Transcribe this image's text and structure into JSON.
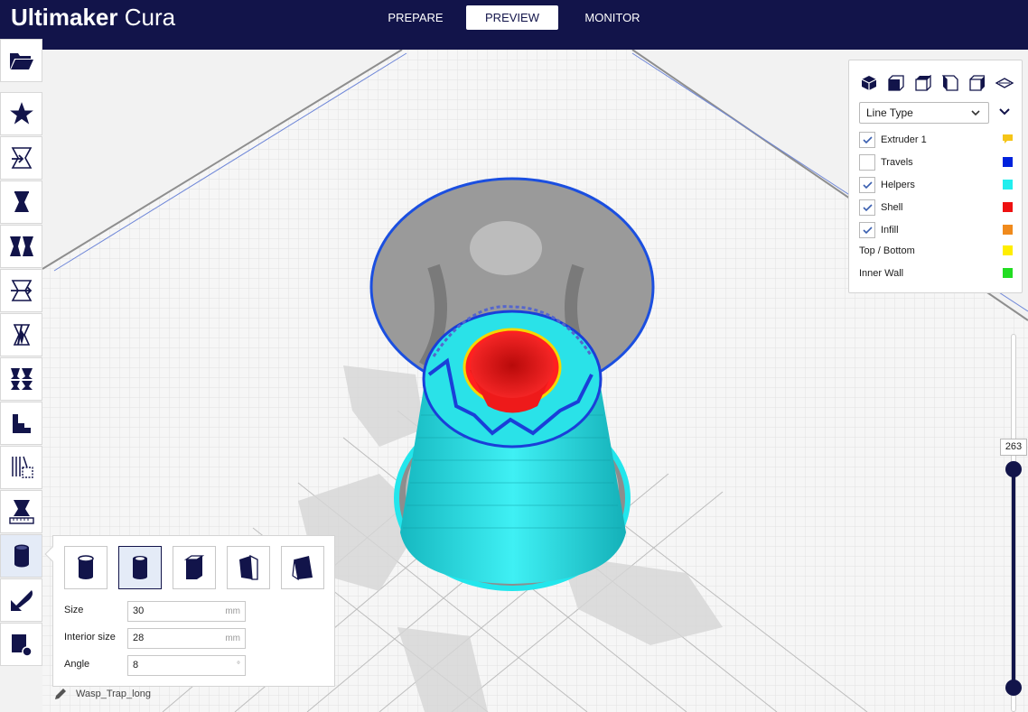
{
  "app": {
    "brand_bold": "Ultimaker",
    "brand_light": "Cura"
  },
  "stages": [
    {
      "label": "PREPARE",
      "active": false
    },
    {
      "label": "PREVIEW",
      "active": true
    },
    {
      "label": "MONITOR",
      "active": false
    }
  ],
  "toolbar": {
    "tools": [
      {
        "name": "open-file-icon"
      },
      {
        "name": "star-icon"
      },
      {
        "name": "translate-tool-icon"
      },
      {
        "name": "scale-tool-icon"
      },
      {
        "name": "rotate-tool-icon"
      },
      {
        "name": "mirror-tool-icon"
      },
      {
        "name": "per-model-settings-icon"
      },
      {
        "name": "support-eraser-icon"
      },
      {
        "name": "staircase-icon"
      },
      {
        "name": "infill-mesh-icon"
      },
      {
        "name": "measure-tool-icon"
      },
      {
        "name": "support-blocker-icon"
      },
      {
        "name": "paint-tool-icon"
      },
      {
        "name": "shape-tool-icon"
      }
    ],
    "active_tool": "support-blocker-icon"
  },
  "view_panel": {
    "camera_icons": [
      "3d-view-icon",
      "front-view-icon",
      "top-view-icon",
      "left-view-icon",
      "right-view-icon",
      "layflat-view-icon"
    ],
    "color_scheme": "Line Type",
    "legend": [
      {
        "label": "Extruder 1",
        "checked": true,
        "has_checkbox": true,
        "color": "#f5c518",
        "swatch": "speech"
      },
      {
        "label": "Travels",
        "checked": false,
        "has_checkbox": true,
        "color": "#0022dd",
        "swatch": "square"
      },
      {
        "label": "Helpers",
        "checked": true,
        "has_checkbox": true,
        "color": "#22eeee",
        "swatch": "square"
      },
      {
        "label": "Shell",
        "checked": true,
        "has_checkbox": true,
        "color": "#ee1111",
        "swatch": "square"
      },
      {
        "label": "Infill",
        "checked": true,
        "has_checkbox": true,
        "color": "#f08a1c",
        "swatch": "square"
      },
      {
        "label": "Top / Bottom",
        "checked": false,
        "has_checkbox": false,
        "color": "#ffee00",
        "swatch": "square"
      },
      {
        "label": "Inner Wall",
        "checked": false,
        "has_checkbox": false,
        "color": "#22dd22",
        "swatch": "square"
      }
    ]
  },
  "layer_slider": {
    "current_layer": "263"
  },
  "support_blocker": {
    "shapes": [
      "cylinder-shape-icon",
      "tube-shape-icon",
      "cube-shape-icon",
      "wedge-shape-icon",
      "tilted-shape-icon"
    ],
    "active_shape": 1,
    "fields": [
      {
        "label": "Size",
        "value": "30",
        "unit": "mm"
      },
      {
        "label": "Interior size",
        "value": "28",
        "unit": "mm"
      },
      {
        "label": "Angle",
        "value": "8",
        "unit": "°"
      }
    ]
  },
  "object": {
    "name": "Wasp_Trap_long"
  },
  "colors": {
    "header": "#12144a",
    "accent": "#12144a",
    "helpers": "#22eeee",
    "shell": "#ee1111",
    "travels": "#0033cc"
  }
}
